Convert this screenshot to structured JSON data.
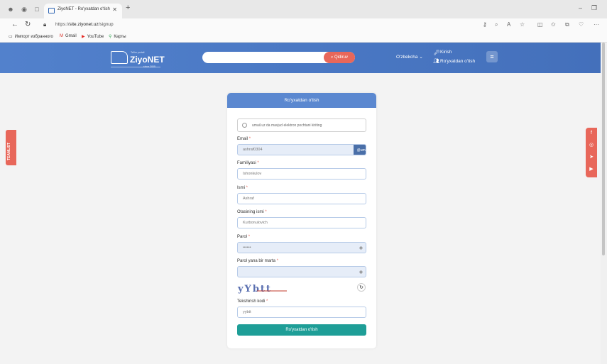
{
  "browser": {
    "tab_title": "ZiyoNET - Ro'yxatdan o'tish",
    "url_prefix": "https://",
    "url_host": "site.ziyonet.uz",
    "url_path": "/signup",
    "bookmarks": [
      {
        "label": "Импорт избранного"
      },
      {
        "label": "Gmail"
      },
      {
        "label": "YouTube"
      },
      {
        "label": "Карты"
      }
    ]
  },
  "header": {
    "logo_small": "Ta'lim portali",
    "logo_text": "ZiyoNET",
    "logo_tagline": "since 2005",
    "search_button": "Qidiruv",
    "language": "O'zbekcha",
    "login": "Kirish",
    "register": "Ro'yxatdan o'tish"
  },
  "feedback_tab": "TEAMLIST",
  "form": {
    "title": "Ro'yxatdan o'tish",
    "info": "umail.uz da mavjud elektron pochtani kiriting",
    "fields": [
      {
        "label": "Email",
        "value": "ashraf0304",
        "suffix": "@umail.uz"
      },
      {
        "label": "Familiyasi",
        "value": "Ishonkulov"
      },
      {
        "label": "Ismi",
        "value": "Ashraf"
      },
      {
        "label": "Otasining ismi",
        "value": "Kurbonulovich"
      },
      {
        "label": "Parol",
        "value": "••••••"
      },
      {
        "label": "Parol yana bir marta",
        "value": ""
      },
      {
        "label": "Tekshirish kodi",
        "value": "yybtt"
      }
    ],
    "captcha_text": "yYbtt",
    "submit": "Ro'yxatdan o'tish"
  },
  "colors": {
    "header": "#4a78c4",
    "card_header": "#5b88d0",
    "accent": "#e8675a",
    "submit": "#1e9e97"
  }
}
